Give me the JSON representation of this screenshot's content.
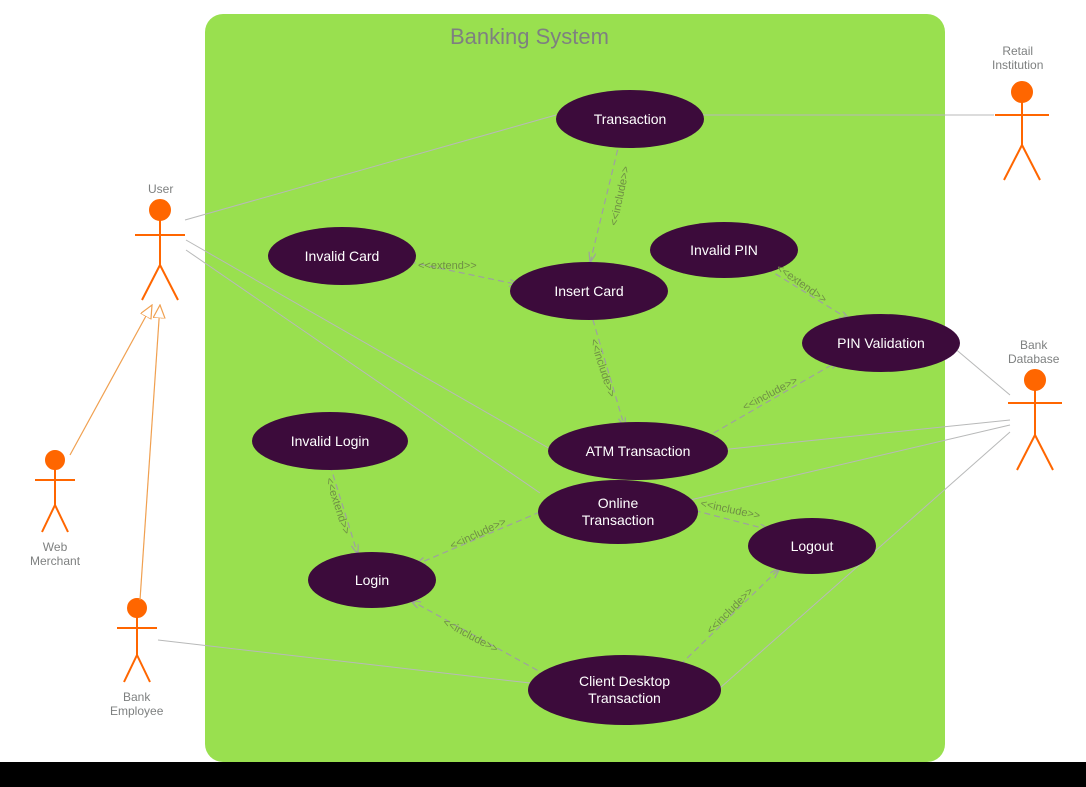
{
  "system": {
    "title": "Banking System"
  },
  "actors": {
    "user": {
      "label": "User"
    },
    "web_merchant": {
      "label": "Web\nMerchant"
    },
    "bank_employee": {
      "label": "Bank\nEmployee"
    },
    "retail_institution": {
      "label": "Retail\nInstitution"
    },
    "bank_database": {
      "label": "Bank\nDatabase"
    }
  },
  "usecases": {
    "transaction": {
      "label": "Transaction"
    },
    "invalid_card": {
      "label": "Invalid Card"
    },
    "invalid_pin": {
      "label": "Invalid PIN"
    },
    "insert_card": {
      "label": "Insert Card"
    },
    "pin_validation": {
      "label": "PIN Validation"
    },
    "invalid_login": {
      "label": "Invalid Login"
    },
    "atm_transaction": {
      "label": "ATM Transaction"
    },
    "online_transaction": {
      "label": "Online\nTransaction"
    },
    "login": {
      "label": "Login"
    },
    "logout": {
      "label": "Logout"
    },
    "client_desktop": {
      "label": "Client Desktop\nTransaction"
    }
  },
  "stereotypes": {
    "include": "<<include>>",
    "extend": "<<extend>>"
  }
}
